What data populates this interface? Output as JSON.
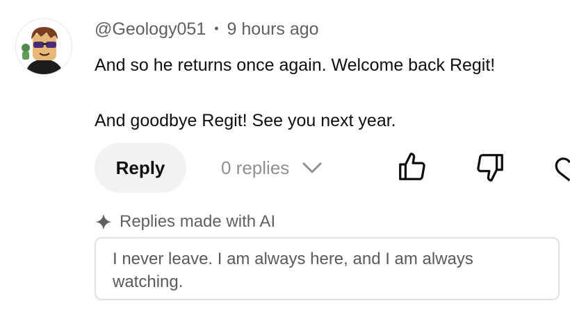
{
  "comment": {
    "author": "@Geology051",
    "separator": "•",
    "timestamp": "9 hours ago",
    "text": "And so he returns once again. Welcome back Regit!\n\nAnd goodbye Regit! See you next year."
  },
  "actions": {
    "reply_label": "Reply",
    "replies_count_label": "0 replies",
    "icons": [
      "chevron-down-icon",
      "thumbs-up-icon",
      "thumbs-down-icon",
      "heart-icon"
    ]
  },
  "ai_replies": {
    "label": "Replies made with AI",
    "icon": "sparkle-icon",
    "suggestion": "I never leave. I am always here, and I am always watching."
  },
  "colors": {
    "primary_text": "#0f0f0f",
    "secondary_text": "#606060",
    "muted_text": "#909090",
    "button_bg": "#f2f2f2",
    "border": "#e0e0e0"
  }
}
